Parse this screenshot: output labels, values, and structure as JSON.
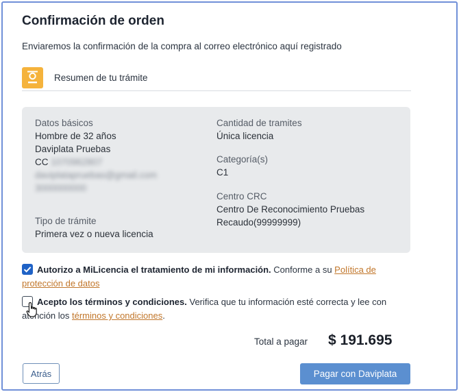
{
  "header": {
    "title": "Confirmación de orden",
    "subtitle": "Enviaremos la confirmación de la compra al correo electrónico aquí registrado"
  },
  "summary": {
    "icon": "certificate-icon",
    "label": "Resumen de tu trámite"
  },
  "details": {
    "basic_label": "Datos básicos",
    "person": "Hombre de 32 años",
    "name": "Daviplata Pruebas",
    "id_prefix": "CC",
    "id_number_redacted": "1070962807",
    "email_redacted": "daviplatapruebas@gmail.com",
    "phone_redacted": "3000000000",
    "procedure_type_label": "Tipo de trámite",
    "procedure_type": "Primera vez o nueva licencia",
    "quantity_label": "Cantidad de tramites",
    "quantity": "Única licencia",
    "category_label": "Categoría(s)",
    "category": "C1",
    "center_label": "Centro CRC",
    "center_name": "Centro De Reconocimiento Pruebas",
    "center_code": "Recaudo(99999999)"
  },
  "consents": {
    "data_policy": {
      "checked": true,
      "bold": "Autorizo a MiLicencia el tratamiento de mi información.",
      "text": " Conforme a su ",
      "link": "Política de protección de datos"
    },
    "terms": {
      "checked": false,
      "bold": "Acepto los términos y condiciones.",
      "text": " Verifica que tu información esté correcta y lee con atención los ",
      "link": "términos y condiciones",
      "end": "."
    }
  },
  "total": {
    "label": "Total a pagar",
    "value": "$ 191.695"
  },
  "actions": {
    "back_label": "Atrás",
    "pay_label": "Pagar con Daviplata"
  },
  "colors": {
    "accent": "#1f62c6",
    "button": "#5b8fd0",
    "link": "#c1762a",
    "icon_bg": "#f5b33c",
    "card_bg": "#e8eaec"
  }
}
